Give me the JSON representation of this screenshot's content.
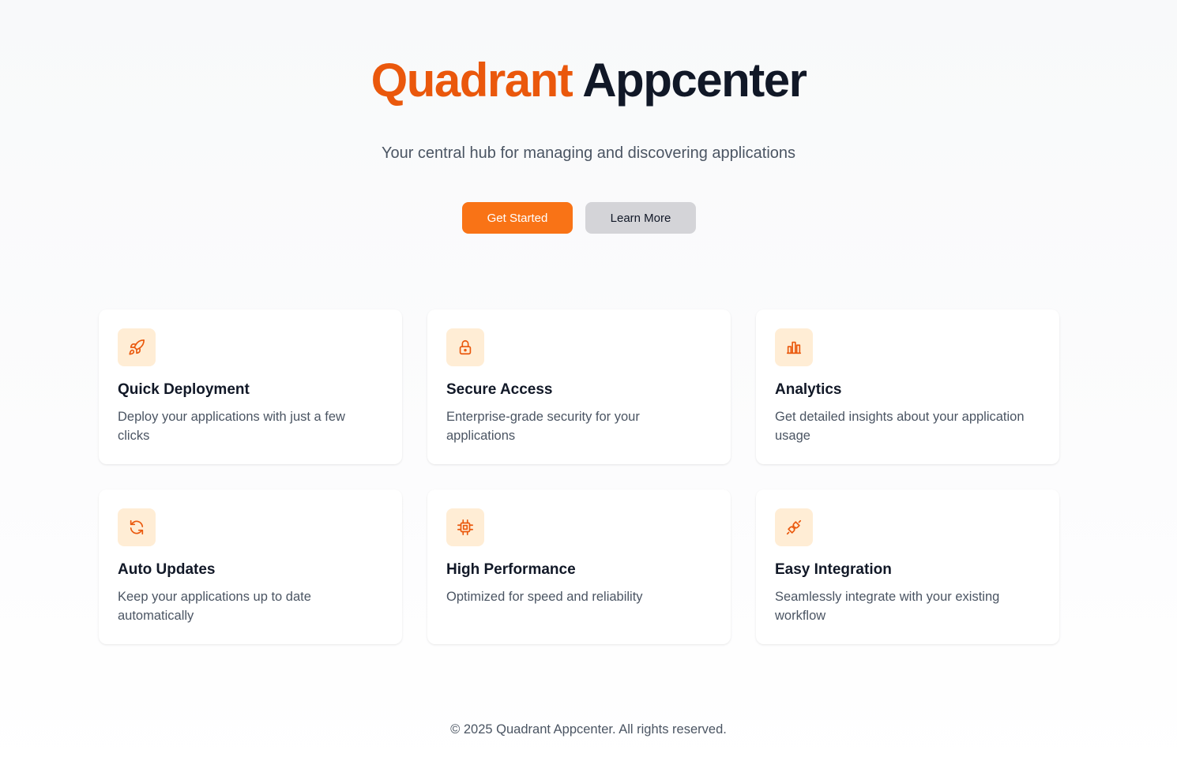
{
  "header": {
    "title_brand": "Quadrant",
    "title_rest": "Appcenter",
    "subtitle": "Your central hub for managing and discovering applications"
  },
  "actions": {
    "primary_label": "Get Started",
    "secondary_label": "Learn More"
  },
  "features": [
    {
      "icon": "rocket-icon",
      "title": "Quick Deployment",
      "description": "Deploy your applications with just a few clicks"
    },
    {
      "icon": "lock-icon",
      "title": "Secure Access",
      "description": "Enterprise-grade security for your applications"
    },
    {
      "icon": "bar-chart-icon",
      "title": "Analytics",
      "description": "Get detailed insights about your application usage"
    },
    {
      "icon": "refresh-icon",
      "title": "Auto Updates",
      "description": "Keep your applications up to date automatically"
    },
    {
      "icon": "cpu-icon",
      "title": "High Performance",
      "description": "Optimized for speed and reliability"
    },
    {
      "icon": "plug-icon",
      "title": "Easy Integration",
      "description": "Seamlessly integrate with your existing workflow"
    }
  ],
  "footer": {
    "copyright": "© 2025 Quadrant Appcenter. All rights reserved."
  },
  "colors": {
    "accent": "#f97316",
    "accent_dark": "#ea580c",
    "icon_bg": "#ffedd5",
    "text_dark": "#111827",
    "text_muted": "#4b5563"
  }
}
